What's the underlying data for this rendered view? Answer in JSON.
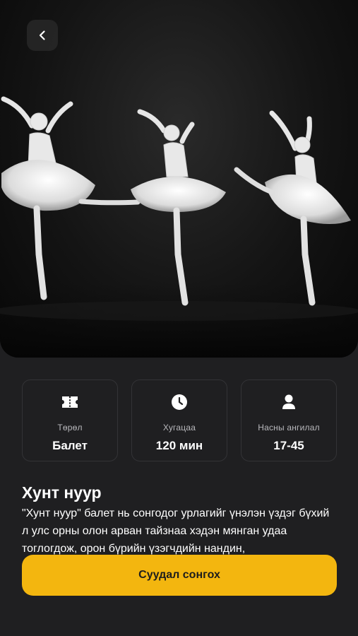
{
  "hero": {
    "image_alt": "Three ballerinas in white tutus on stage",
    "back_icon": "chevron-left-icon"
  },
  "info_cards": [
    {
      "icon": "ticket-icon",
      "label": "Төрөл",
      "value": "Балет"
    },
    {
      "icon": "clock-icon",
      "label": "Хугацаа",
      "value": "120 мин"
    },
    {
      "icon": "person-icon",
      "label": "Насны ангилал",
      "value": "17-45"
    }
  ],
  "show": {
    "title": "Хунт нуур",
    "description": "\"Хунт нуур\" балет нь сонгодог урлагийг үнэлэн үздэг бүхий л улс орны олон арван тайзнаа хэдэн мянган удаа тоглогдож, орон бүрийн үзэгчдийн нандин,"
  },
  "cta": {
    "label": "Суудал сонгох"
  },
  "colors": {
    "background": "#1f1f21",
    "accent": "#f3b60f",
    "card_border": "#333336"
  }
}
